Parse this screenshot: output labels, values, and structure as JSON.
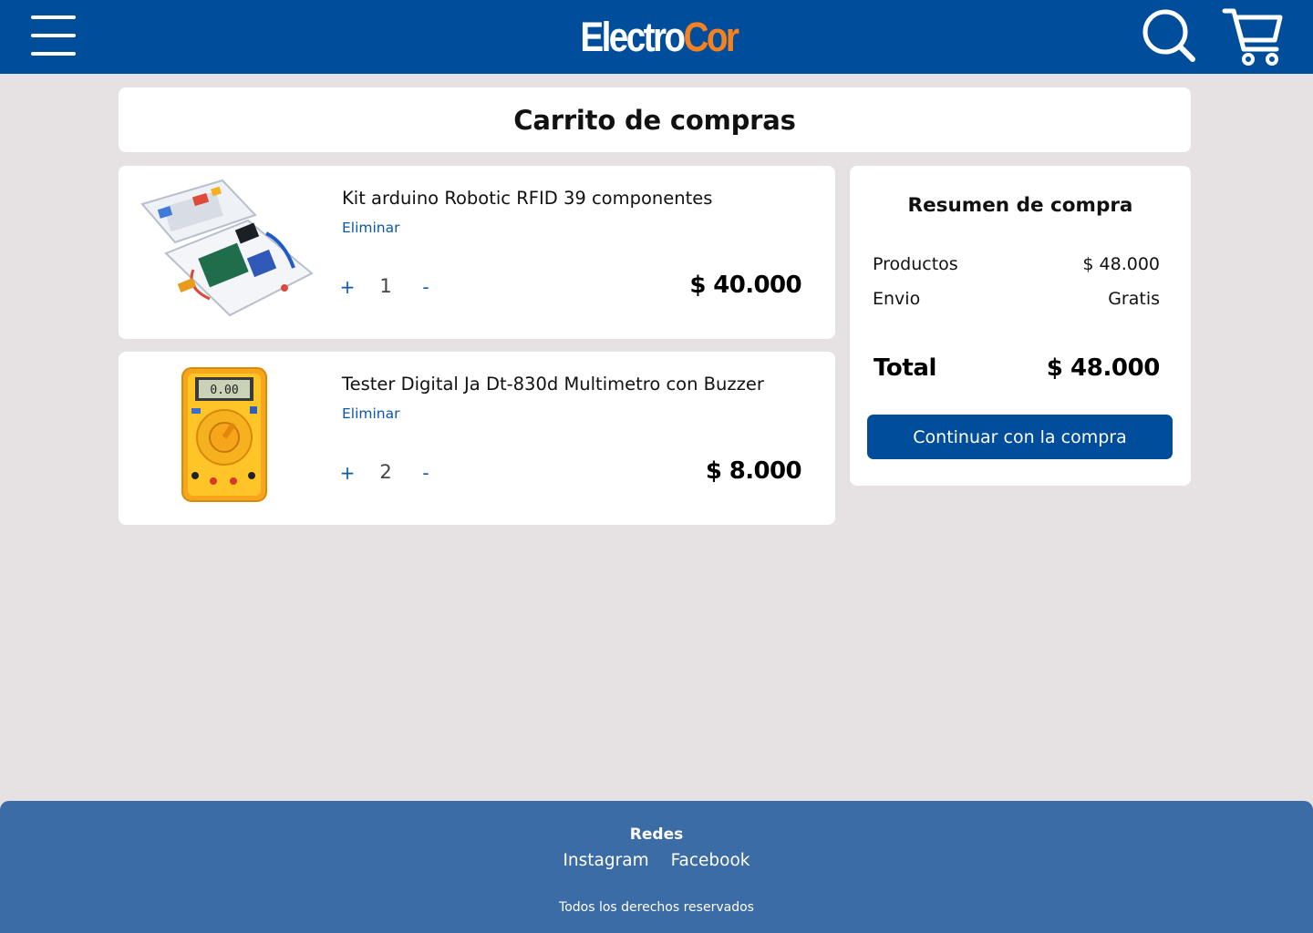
{
  "colors": {
    "header_bg": "#004e9b",
    "logo_primary": "#ffffff",
    "logo_accent": "#f58220",
    "link_blue": "#0a58a8",
    "button_bg": "#004e9b",
    "footer_bg": "#3b6ca6",
    "page_bg": "#e6e2e3"
  },
  "header": {
    "menu_icon": "hamburger-menu-icon",
    "logo_part1": "Electro",
    "logo_part2": "Cor",
    "search_icon": "search-icon",
    "cart_icon": "shopping-cart-icon"
  },
  "page": {
    "title": "Carrito de compras"
  },
  "cart": {
    "items": [
      {
        "name": "Kit arduino Robotic RFID 39 componentes",
        "remove_label": "Eliminar",
        "increase_label": "+",
        "quantity": "1",
        "decrease_label": "-",
        "price": "$ 40.000",
        "image_icon": "arduino-kit-image"
      },
      {
        "name": "Tester Digital Ja Dt-830d Multimetro con Buzzer",
        "remove_label": "Eliminar",
        "increase_label": "+",
        "quantity": "2",
        "decrease_label": "-",
        "price": "$ 8.000",
        "image_icon": "multimeter-image",
        "display_reading": "0.00"
      }
    ]
  },
  "summary": {
    "title": "Resumen de compra",
    "products_label": "Productos",
    "products_value": "$ 48.000",
    "shipping_label": "Envio",
    "shipping_value": "Gratis",
    "total_label": "Total",
    "total_value": "$ 48.000",
    "continue_label": "Continuar con la compra"
  },
  "footer": {
    "heading": "Redes",
    "links": [
      "Instagram",
      "Facebook"
    ],
    "rights": "Todos los derechos reservados"
  }
}
